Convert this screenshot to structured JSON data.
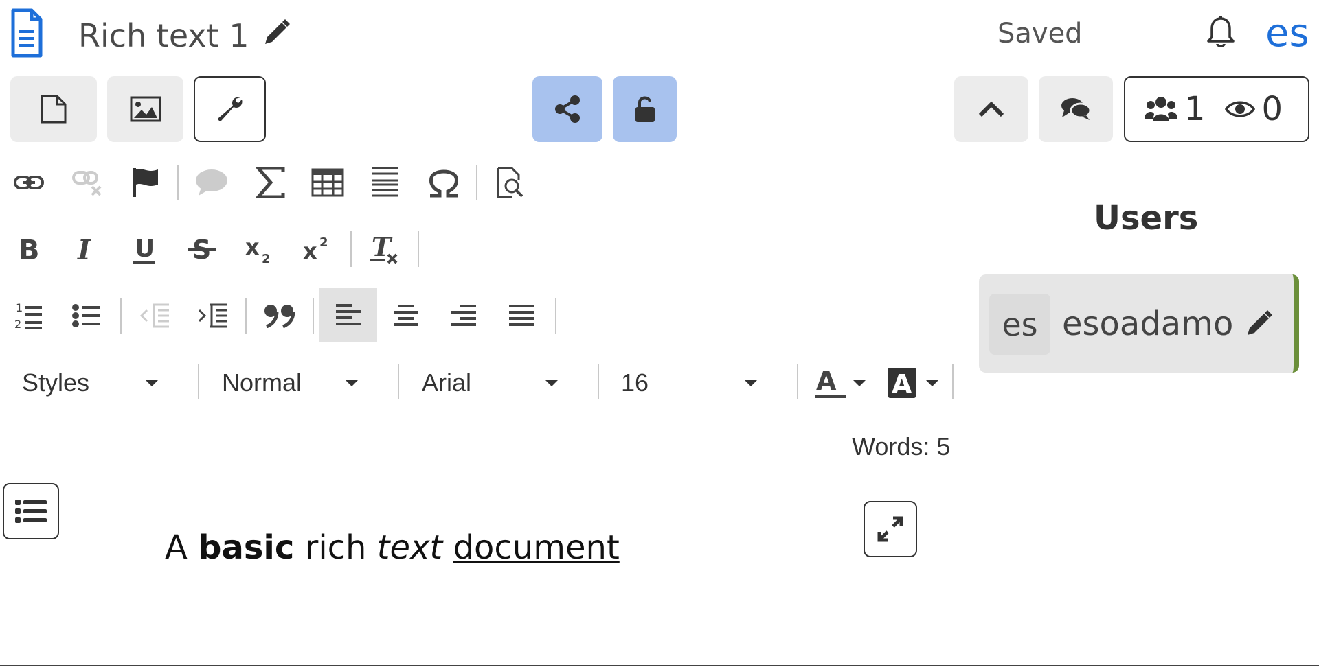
{
  "header": {
    "doc_icon": "document-icon",
    "title": "Rich text 1",
    "save_status": "Saved",
    "user_lang": "es"
  },
  "toolbar_top": {
    "buttons": [
      "new-document-icon",
      "image-icon",
      "wrench-icon",
      "share-icon",
      "unlock-icon",
      "chevron-up-icon",
      "comments-icon"
    ],
    "users_online": "1",
    "viewers": "0"
  },
  "editor_toolbar": {
    "row1": [
      "link-icon",
      "unlink-icon",
      "anchor-flag-icon",
      "comment-icon",
      "sigma-icon",
      "table-icon",
      "horizontal-lines-icon",
      "omega-icon",
      "preview-icon"
    ],
    "row2": [
      "bold-icon",
      "italic-icon",
      "underline-icon",
      "strikethrough-icon",
      "subscript-icon",
      "superscript-icon",
      "remove-format-icon"
    ],
    "row3": [
      "numbered-list-icon",
      "bullet-list-icon",
      "outdent-icon",
      "indent-icon",
      "blockquote-icon",
      "align-left-icon",
      "align-center-icon",
      "align-right-icon",
      "justify-icon"
    ],
    "styles": "Styles",
    "format": "Normal",
    "font": "Arial",
    "size": "16"
  },
  "word_count": "Words: 5",
  "users_panel": {
    "heading": "Users",
    "users": [
      {
        "avatar": "es",
        "name": "esoadamo"
      }
    ]
  },
  "document": {
    "t1": "A ",
    "t2": "basic",
    "t3": " rich ",
    "t4": "text",
    "t5": " ",
    "t6": "document"
  }
}
